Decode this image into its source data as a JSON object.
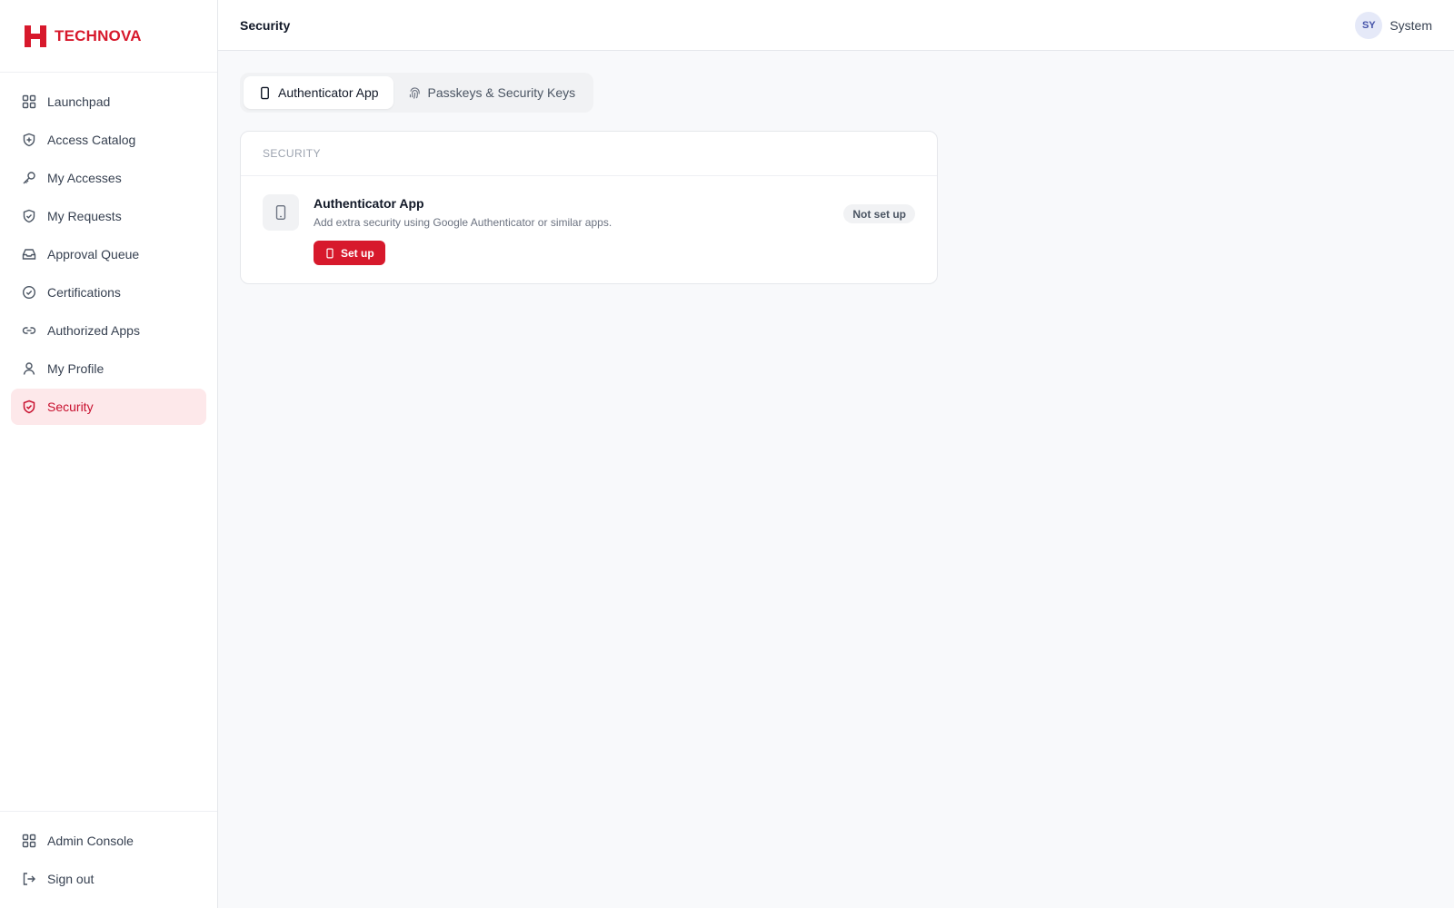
{
  "brand": {
    "name": "TECHNOVA",
    "color": "#d7192c"
  },
  "sidebar": {
    "items": [
      {
        "label": "Launchpad",
        "icon": "grid-icon"
      },
      {
        "label": "Access Catalog",
        "icon": "shield-plus-icon"
      },
      {
        "label": "My Accesses",
        "icon": "key-icon"
      },
      {
        "label": "My Requests",
        "icon": "shield-check-icon"
      },
      {
        "label": "Approval Queue",
        "icon": "inbox-icon"
      },
      {
        "label": "Certifications",
        "icon": "check-circle-icon"
      },
      {
        "label": "Authorized Apps",
        "icon": "link-icon"
      },
      {
        "label": "My Profile",
        "icon": "user-icon"
      },
      {
        "label": "Security",
        "icon": "shield-icon",
        "active": true
      }
    ],
    "bottom": [
      {
        "label": "Admin Console",
        "icon": "grid-icon"
      },
      {
        "label": "Sign out",
        "icon": "sign-out-icon"
      }
    ]
  },
  "header": {
    "title": "Security",
    "user": {
      "initials": "SY",
      "name": "System"
    }
  },
  "tabs": [
    {
      "label": "Authenticator App",
      "icon": "phone-icon",
      "active": true
    },
    {
      "label": "Passkeys & Security Keys",
      "icon": "fingerprint-icon",
      "active": false
    }
  ],
  "card": {
    "section_label": "SECURITY",
    "row": {
      "title": "Authenticator App",
      "description": "Add extra security using Google Authenticator or similar apps.",
      "button_label": "Set up",
      "status": "Not set up"
    }
  },
  "colors": {
    "accent": "#d7192c",
    "active_bg": "#fde8ea",
    "avatar_bg": "#e5e9f8"
  }
}
